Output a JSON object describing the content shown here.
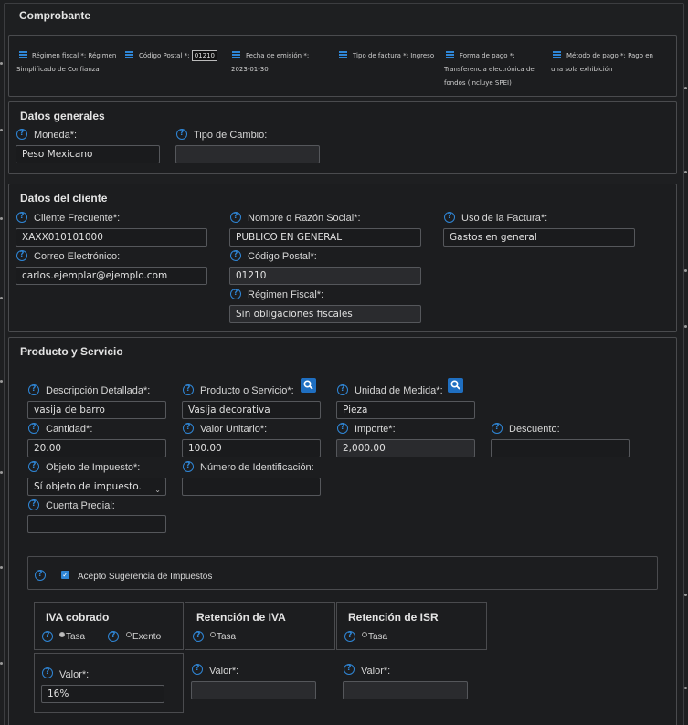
{
  "comprobante": {
    "title": "Comprobante",
    "regimen_label": "Régimen fiscal *:",
    "regimen_value": "Régimen Simplificado de Confianza",
    "cp_label": "Código Postal *:",
    "cp_value": "01210",
    "fecha_label": "Fecha de emisión *:",
    "fecha_value": "2023-01-30",
    "tipo_label": "Tipo de factura *:",
    "tipo_value": "Ingreso",
    "forma_label": "Forma de pago *:",
    "forma_value": "Transferencia electrónica de fondos (Incluye SPEI)",
    "metodo_label": "Método de pago *:",
    "metodo_value": "Pago en una sola exhibición"
  },
  "datos_generales": {
    "title": "Datos generales",
    "moneda_label": "Moneda*:",
    "moneda_value": "Peso Mexicano",
    "tipo_cambio_label": "Tipo de Cambio:",
    "tipo_cambio_value": ""
  },
  "cliente": {
    "title": "Datos del cliente",
    "frecuente_label": "Cliente Frecuente*:",
    "frecuente_value": "XAXX010101000",
    "nombre_label": "Nombre o Razón Social*:",
    "nombre_value": "PUBLICO EN GENERAL",
    "uso_label": "Uso de la Factura*:",
    "uso_value": "Gastos en general",
    "correo_label": "Correo Electrónico:",
    "correo_value": "carlos.ejemplar@ejemplo.com",
    "cp_label": "Código Postal*:",
    "cp_value": "01210",
    "regimen_label": "Régimen Fiscal*:",
    "regimen_value": "Sin obligaciones fiscales"
  },
  "producto": {
    "title": "Producto y Servicio",
    "descripcion_label": "Descripción Detallada*:",
    "descripcion_value": "vasija de barro",
    "producto_label": "Producto o Servicio*:",
    "producto_value": "Vasija decorativa",
    "unidad_label": "Unidad de Medida*:",
    "unidad_value": "Pieza",
    "cantidad_label": "Cantidad*:",
    "cantidad_value": "20.00",
    "valor_label": "Valor Unitario*:",
    "valor_value": "100.00",
    "importe_label": "Importe*:",
    "importe_value": "2,000.00",
    "descuento_label": "Descuento:",
    "descuento_value": "",
    "objeto_label": "Objeto de Impuesto*:",
    "objeto_value": "Sí objeto de impuesto.",
    "numero_label": "Número de Identificación:",
    "numero_value": "",
    "cuenta_label": "Cuenta Predial:",
    "cuenta_value": "",
    "sugerencia_label": "Acepto Sugerencia de Impuestos",
    "sugerencia_checked": true
  },
  "impuestos": {
    "iva": {
      "title": "IVA cobrado",
      "tasa": "Tasa",
      "exento": "Exento",
      "valor_label": "Valor*:",
      "valor_value": "16%",
      "selected": "Tasa"
    },
    "ret_iva": {
      "title": "Retención de IVA",
      "tasa": "Tasa",
      "valor_label": "Valor*:",
      "valor_value": ""
    },
    "ret_isr": {
      "title": "Retención de ISR",
      "tasa": "Tasa",
      "valor_label": "Valor*:",
      "valor_value": ""
    }
  },
  "colors": {
    "accent": "#2f86d6",
    "background": "#1e1f21",
    "border": "#4a4b4e"
  },
  "icons": {
    "help": "question-circle-icon",
    "menu": "list-icon",
    "search": "magnifier-icon",
    "select": "chevron-down-icon"
  }
}
